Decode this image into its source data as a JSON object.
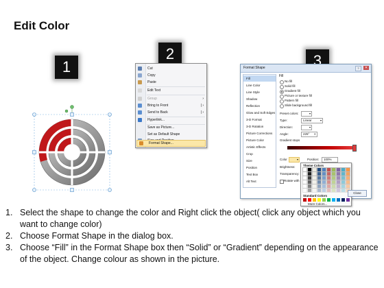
{
  "title": "Edit Color",
  "badges": [
    "1",
    "2",
    "3"
  ],
  "colors": {
    "accent_red": "#c0181b",
    "gray_ring": "#9a9a9a",
    "dark_gray": "#6d6d6d",
    "badge_bg": "#111111",
    "highlight": "#fbe7a8"
  },
  "context_menu": {
    "items": [
      {
        "label": "Cut",
        "icon": "scissors-icon",
        "disabled": false,
        "submenu": false
      },
      {
        "label": "Copy",
        "icon": "copy-icon",
        "disabled": false,
        "submenu": false
      },
      {
        "label": "Paste",
        "icon": "paste-icon",
        "disabled": false,
        "submenu": false
      },
      {
        "label": "Edit Text",
        "icon": "edit-text-icon",
        "disabled": false,
        "submenu": false
      },
      {
        "label": "Group",
        "icon": "group-icon",
        "disabled": true,
        "submenu": true
      },
      {
        "label": "Bring to Front",
        "icon": "bring-front-icon",
        "disabled": false,
        "submenu": true
      },
      {
        "label": "Send to Back",
        "icon": "send-back-icon",
        "disabled": false,
        "submenu": true
      },
      {
        "label": "Hyperlink...",
        "icon": "hyperlink-icon",
        "disabled": false,
        "submenu": false
      },
      {
        "label": "Save as Picture...",
        "icon": "",
        "disabled": false,
        "submenu": false
      },
      {
        "label": "Set as Default Shape",
        "icon": "",
        "disabled": false,
        "submenu": false
      },
      {
        "label": "Size and Position...",
        "icon": "size-icon",
        "disabled": false,
        "submenu": false
      },
      {
        "label": "Format Shape...",
        "icon": "format-shape-icon",
        "disabled": false,
        "submenu": false
      }
    ]
  },
  "dialog": {
    "title": "Format Shape",
    "nav": [
      "Fill",
      "Line Color",
      "Line Style",
      "Shadow",
      "Reflection",
      "Glow and Soft Edges",
      "3-D Format",
      "3-D Rotation",
      "Picture Corrections",
      "Picture Color",
      "Artistic Effects",
      "Crop",
      "Size",
      "Position",
      "Text Box",
      "Alt Text"
    ],
    "section": "Fill",
    "fill_options": [
      "No fill",
      "Solid fill",
      "Gradient fill",
      "Picture or texture fill",
      "Pattern fill",
      "Slide background fill"
    ],
    "preset_label": "Preset colors:",
    "type_label": "Type:",
    "type_value": "Linear",
    "direction_label": "Direction:",
    "angle_label": "Angle:",
    "angle_value": "225°",
    "stops_label": "Gradient stops",
    "color_label": "Color",
    "position_label": "Position:",
    "position_value": "100%",
    "brightness_label": "Brightness:",
    "transparency_label": "Transparency:",
    "rotate_label": "Rotate with shape",
    "close_label": "Close",
    "palette": {
      "theme_header": "Theme Colors",
      "standard_header": "Standard Colors",
      "more": "More Colors..."
    }
  },
  "steps": [
    "Select the shape to change the color and Right click the object( click any object which you want to change color)",
    "Choose Format Shape in the dialog box.",
    "Choose “Fill” in the Format Shape box then “Solid” or “Gradient” depending on the appearance of the object. Change colour as shown in the picture."
  ]
}
